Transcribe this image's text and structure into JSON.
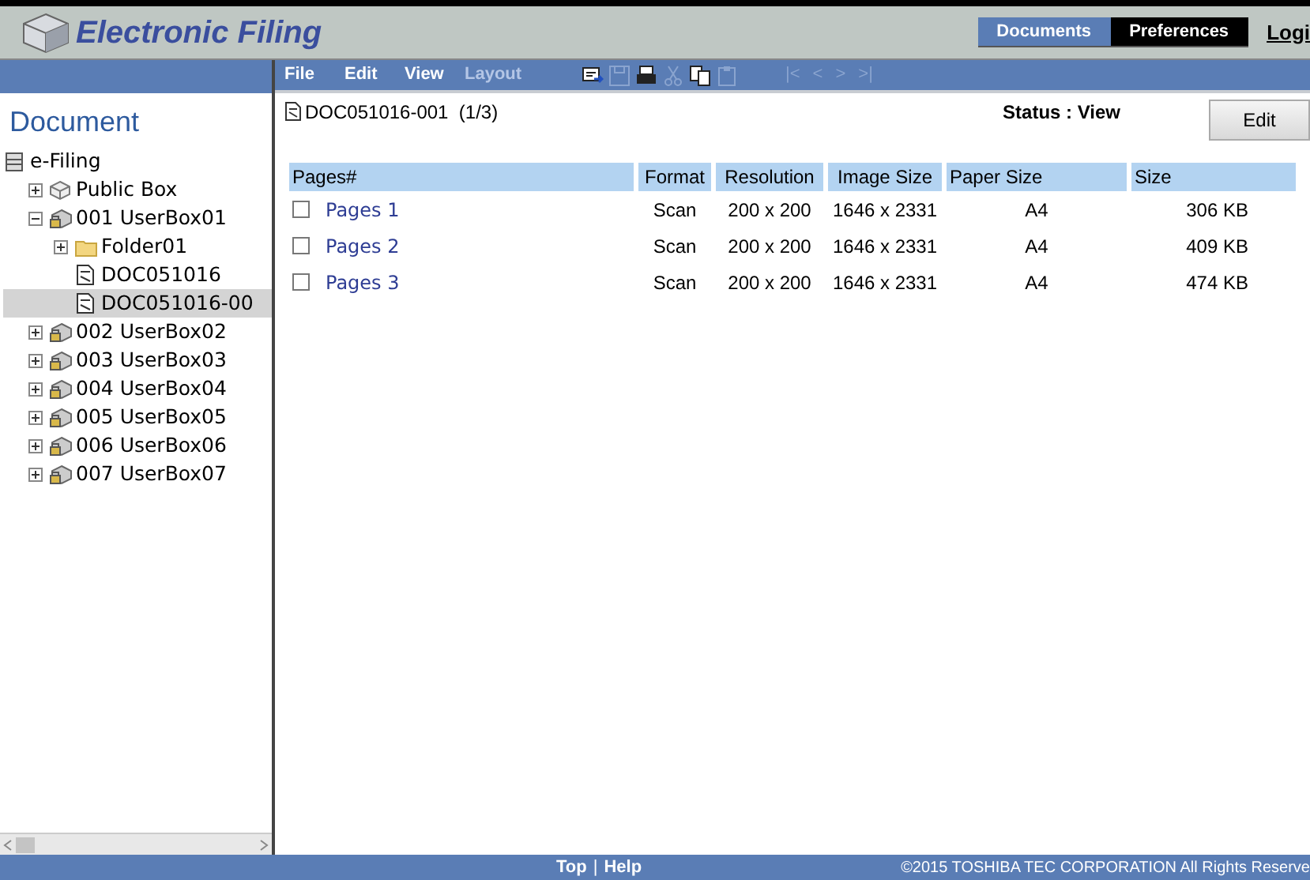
{
  "header": {
    "title": "Electronic Filing",
    "tabs": [
      {
        "label": "Documents",
        "selected": true
      },
      {
        "label": "Preferences",
        "selected": false
      }
    ],
    "login_link": "Logi"
  },
  "menu": [
    {
      "label": "File",
      "disabled": false
    },
    {
      "label": "Edit",
      "disabled": false
    },
    {
      "label": "View",
      "disabled": false
    },
    {
      "label": "Layout",
      "disabled": true
    }
  ],
  "toolbar": [
    {
      "kind": "export",
      "disabled": false
    },
    {
      "kind": "save",
      "disabled": true
    },
    {
      "kind": "print",
      "disabled": false
    },
    {
      "kind": "cut",
      "disabled": true
    },
    {
      "kind": "copy",
      "disabled": false
    },
    {
      "kind": "paste",
      "disabled": true
    }
  ],
  "pager": [
    {
      "label": "|<",
      "disabled": true
    },
    {
      "label": "<",
      "disabled": true
    },
    {
      "label": ">",
      "disabled": true
    },
    {
      "label": ">|",
      "disabled": true
    }
  ],
  "sidebar": {
    "title": "Document",
    "tree": [
      {
        "label": "e-Filing",
        "kind": "root",
        "selected": false,
        "children": [
          {
            "label": "Public Box",
            "kind": "public",
            "expanded": false,
            "selected": false
          },
          {
            "label": "001 UserBox01",
            "kind": "userbox",
            "expanded": true,
            "selected": false,
            "children": [
              {
                "label": "Folder01",
                "kind": "folder",
                "expanded": false,
                "selected": false
              },
              {
                "label": "DOC051016",
                "kind": "document",
                "selected": false
              },
              {
                "label": "DOC051016-00",
                "kind": "document",
                "selected": true
              }
            ]
          },
          {
            "label": "002 UserBox02",
            "kind": "userbox",
            "expanded": false,
            "selected": false
          },
          {
            "label": "003 UserBox03",
            "kind": "userbox",
            "expanded": false,
            "selected": false
          },
          {
            "label": "004 UserBox04",
            "kind": "userbox",
            "expanded": false,
            "selected": false
          },
          {
            "label": "005 UserBox05",
            "kind": "userbox",
            "expanded": false,
            "selected": false
          },
          {
            "label": "006 UserBox06",
            "kind": "userbox",
            "expanded": false,
            "selected": false
          },
          {
            "label": "007 UserBox07",
            "kind": "userbox",
            "expanded": false,
            "selected": false
          }
        ]
      }
    ]
  },
  "document": {
    "name": "DOC051016-001  (1/3)",
    "status": "Status : View",
    "edit_button": "Edit"
  },
  "table": {
    "columns": [
      "Pages#",
      "Format",
      "Resolution",
      "Image Size",
      "Paper Size",
      "Size"
    ],
    "rows": [
      {
        "checked": false,
        "cells": [
          "Pages 1",
          "Scan",
          "200 x 200",
          "1646 x 2331",
          "A4",
          "306 KB"
        ]
      },
      {
        "checked": false,
        "cells": [
          "Pages 2",
          "Scan",
          "200 x 200",
          "1646 x 2331",
          "A4",
          "409 KB"
        ]
      },
      {
        "checked": false,
        "cells": [
          "Pages 3",
          "Scan",
          "200 x 200",
          "1646 x 2331",
          "A4",
          "474 KB"
        ]
      }
    ]
  },
  "footer": {
    "links": [
      "Top",
      "Help"
    ],
    "separator": "|",
    "copyright": "©2015 TOSHIBA TEC CORPORATION All Rights Reserve"
  }
}
